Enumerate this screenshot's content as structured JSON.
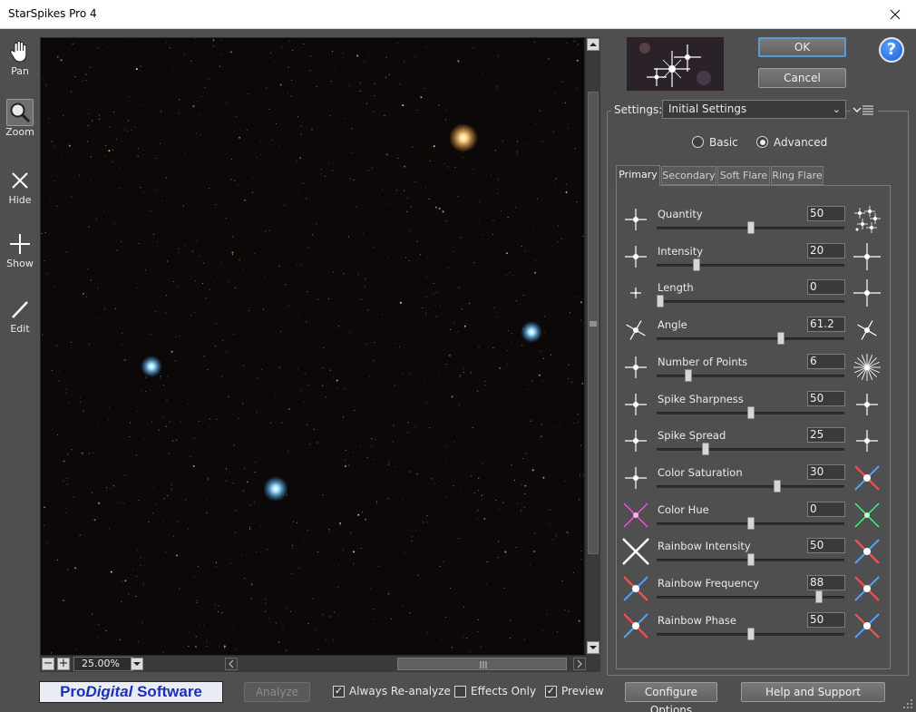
{
  "window": {
    "title": "StarSpikes Pro 4"
  },
  "tools": [
    {
      "label": "Pan",
      "icon": "hand-icon"
    },
    {
      "label": "Zoom",
      "icon": "magnifier-icon"
    },
    {
      "label": "Hide",
      "icon": "x-cross-icon"
    },
    {
      "label": "Show",
      "icon": "plus-icon"
    },
    {
      "label": "Edit",
      "icon": "pencil-icon"
    }
  ],
  "zoom": {
    "minus": "−",
    "plus": "+",
    "value": "25.00%"
  },
  "buttons": {
    "ok": "OK",
    "cancel": "Cancel",
    "help": "?"
  },
  "settings": {
    "label": "Settings:",
    "value": "Initial Settings"
  },
  "mode": {
    "basic": "Basic",
    "advanced": "Advanced",
    "selected": "Advanced"
  },
  "tabs": [
    "Primary",
    "Secondary",
    "Soft Flare",
    "Ring Flare"
  ],
  "sliders": [
    {
      "name": "Quantity",
      "value": "50",
      "pos": 0.5
    },
    {
      "name": "Intensity",
      "value": "20",
      "pos": 0.2
    },
    {
      "name": "Length",
      "value": "0",
      "pos": 0.0
    },
    {
      "name": "Angle",
      "value": "61.2",
      "pos": 0.667
    },
    {
      "name": "Number of Points",
      "value": "6",
      "pos": 0.154
    },
    {
      "name": "Spike Sharpness",
      "value": "50",
      "pos": 0.5
    },
    {
      "name": "Spike Spread",
      "value": "25",
      "pos": 0.25
    },
    {
      "name": "Color Saturation",
      "value": "30",
      "pos": 0.65
    },
    {
      "name": "Color Hue",
      "value": "0",
      "pos": 0.5
    },
    {
      "name": "Rainbow Intensity",
      "value": "50",
      "pos": 0.5
    },
    {
      "name": "Rainbow Frequency",
      "value": "88",
      "pos": 0.88
    },
    {
      "name": "Rainbow Phase",
      "value": "50",
      "pos": 0.5
    }
  ],
  "footer": {
    "brand_pre": "Pro",
    "brand_mid": "Digital",
    "brand_post": " Software",
    "analyze": "Analyze",
    "always_reanalyze": "Always Re-analyze",
    "effects_only": "Effects Only",
    "preview": "Preview",
    "configure": "Configure Options",
    "help_support": "Help and Support"
  },
  "checks": {
    "always_reanalyze": true,
    "effects_only": false,
    "preview": true
  },
  "colors": {
    "background": "#4f4f4f",
    "canvas": "#0c0807",
    "accent": "#5a9bd5",
    "brand": "#1c2fb8"
  }
}
